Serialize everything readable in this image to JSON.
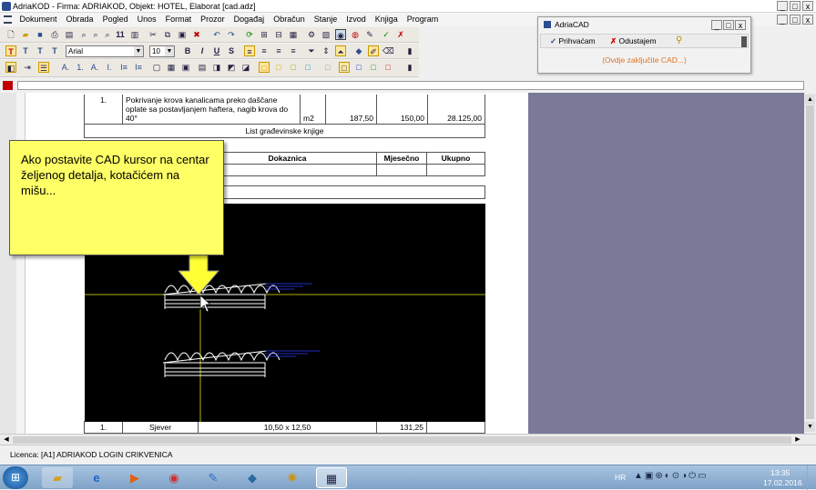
{
  "app": {
    "title": "AdriaKOD - Firma: ADRIAKOD,   Objekt: HOTEL, Elaborat [cad.adz]",
    "controls": [
      "_",
      "□",
      "x"
    ]
  },
  "menu": [
    "Dokument",
    "Obrada",
    "Pogled",
    "Unos",
    "Format",
    "Prozor",
    "Događaj",
    "Obračun",
    "Stanje",
    "Izvod",
    "Knjiga",
    "Program"
  ],
  "format_toolbar": {
    "text_buttons": [
      "T",
      "T",
      "T",
      "T"
    ],
    "font": "Arial",
    "size": "10",
    "styles": [
      "B",
      "I",
      "U",
      "S"
    ]
  },
  "toolbar3": {
    "items": [
      "A.",
      "1.",
      "A.",
      "I.",
      "I≡",
      "I≡"
    ]
  },
  "document": {
    "row1": {
      "num": "1.",
      "desc": "Pokrivanje krova kanalicama preko daščane oplate sa postavljanjem haftera, nagib krova do 40°",
      "unit": "m2",
      "qty": "187,50",
      "price": "150,00",
      "total": "28.125,00"
    },
    "list_title": "List građevinske knjige",
    "header": {
      "col_dokaznica": "Dokaznica",
      "col_mjesecno": "Mjesečno",
      "col_ukupno": "Ukupno"
    },
    "bottom_row": {
      "num": "1.",
      "name": "Sjever",
      "dims": "10,50 x 12,50",
      "value": "131,25"
    }
  },
  "callout": {
    "text": "Ako postavite CAD kursor na centar željenog detalja, kotačićem na mišu..."
  },
  "adriacad": {
    "title": "AdriaCAD",
    "accept": "Prihvaćam",
    "cancel": "Odustajem",
    "hint": "(Ovdje zaključite CAD...)"
  },
  "statusbar": {
    "licence": "Licenca: [A1] ADRIAKOD LOGIN CRIKVENICA"
  },
  "taskbar": {
    "lang": "HR",
    "time": "13:35",
    "date": "17.02.2016."
  },
  "colors": {
    "workspace": "#7a7a98",
    "callout": "#ffff66",
    "cad_bg": "#000000",
    "cad_crosshair": "#e8e800",
    "cad_dimension": "#2a3cff",
    "accent_red": "#c00000"
  }
}
